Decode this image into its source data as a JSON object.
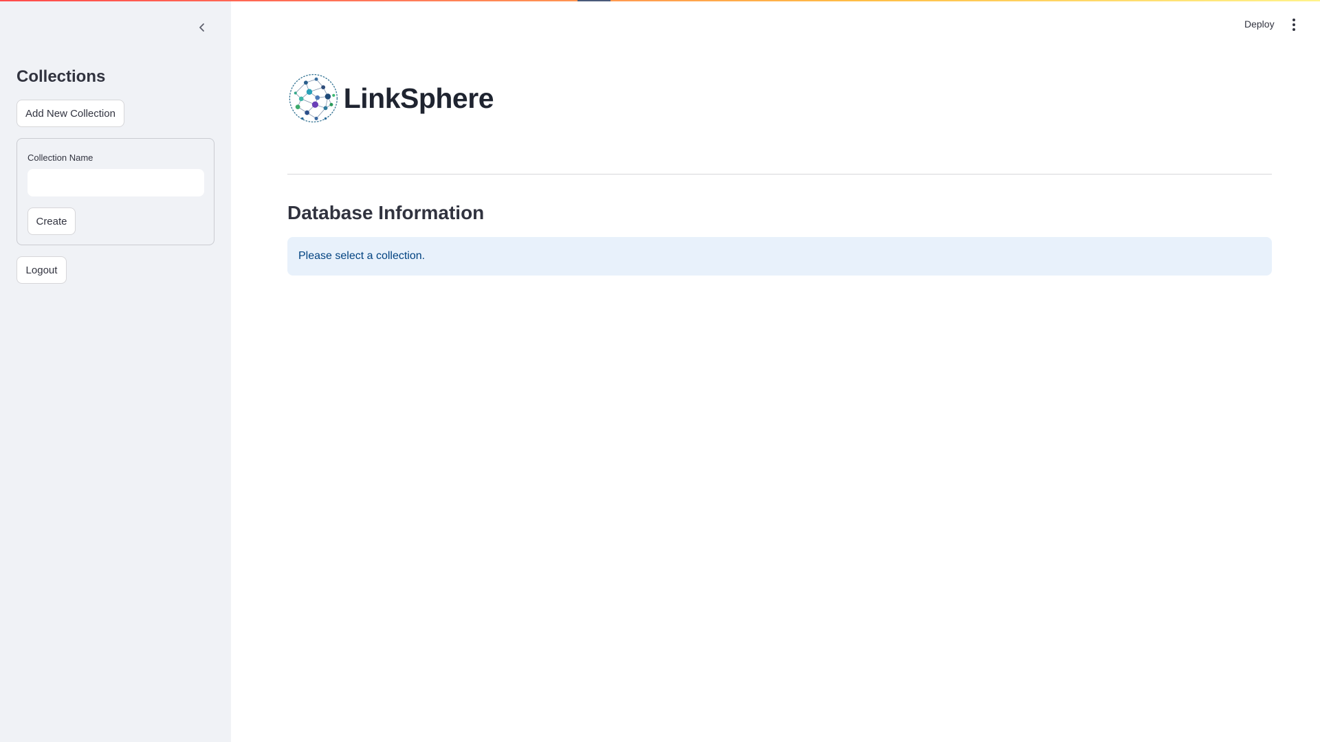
{
  "sidebar": {
    "title": "Collections",
    "add_button_label": "Add New Collection",
    "form": {
      "field_label": "Collection Name",
      "field_value": "",
      "create_button_label": "Create"
    },
    "logout_button_label": "Logout",
    "collapse_icon": "chevron-left-icon"
  },
  "header": {
    "deploy_label": "Deploy",
    "menu_icon": "kebab-menu-icon"
  },
  "main": {
    "brand_name": "LinkSphere",
    "section_title": "Database Information",
    "info_message": "Please select a collection."
  },
  "colors": {
    "sidebar_bg": "#f0f2f6",
    "info_bg": "#e8f1fb",
    "info_text": "#004280",
    "text": "#31333f"
  }
}
